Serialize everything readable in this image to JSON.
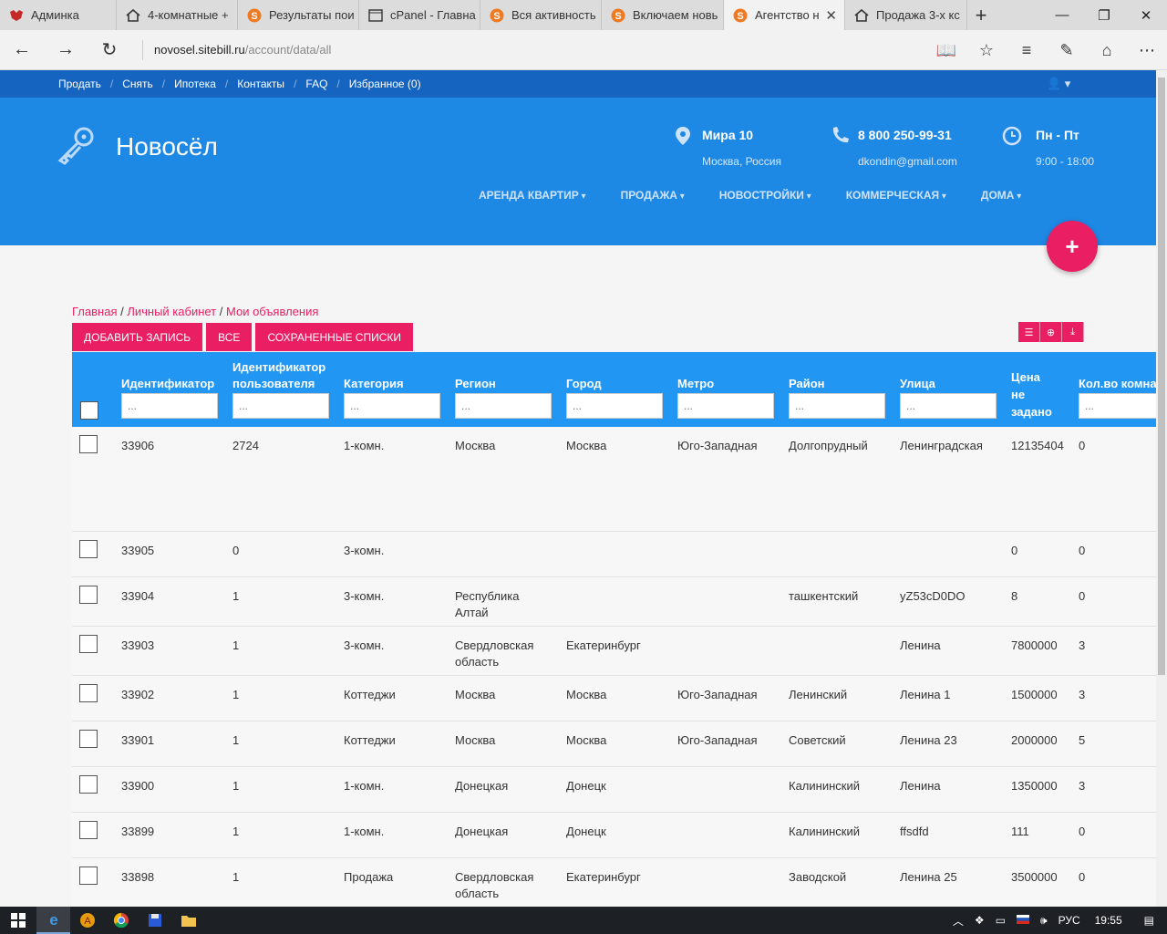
{
  "browser": {
    "tabs": [
      {
        "title": "Админка",
        "icon": "dog-icon"
      },
      {
        "title": "4-комнатные +",
        "icon": "house-icon"
      },
      {
        "title": "Результаты пои",
        "icon": "s-logo-icon"
      },
      {
        "title": "cPanel - Главна",
        "icon": "page-icon"
      },
      {
        "title": "Вся активность",
        "icon": "s-logo-icon"
      },
      {
        "title": "Включаем новь",
        "icon": "s-logo-icon"
      },
      {
        "title": "Агентство н",
        "icon": "s-logo-icon",
        "active": true
      },
      {
        "title": "Продажа 3-х кс",
        "icon": "house-icon"
      }
    ],
    "url_host": "novosel.sitebill.ru",
    "url_path": "/account/data/all"
  },
  "site": {
    "topnav": [
      "Продать",
      "Снять",
      "Ипотека",
      "Контакты",
      "FAQ",
      "Избранное (0)"
    ],
    "brand": "Новосёл",
    "address_title": "Мира 10",
    "address_sub": "Москва, Россия",
    "phone_title": "8 800 250-99-31",
    "phone_sub": "dkondin@gmail.com",
    "hours_title": "Пн - Пт",
    "hours_sub": "9:00 - 18:00",
    "menu": [
      "АРЕНДА КВАРТИР",
      "ПРОДАЖА",
      "НОВОСТРОЙКИ",
      "КОММЕРЧЕСКАЯ",
      "ДОМА"
    ],
    "fab_label": "+",
    "accent": "#e91e63",
    "header_color": "#1e88e5",
    "topbar_color": "#1565c0"
  },
  "breadcrumb": {
    "items": [
      "Главная",
      "Личный кабинет",
      "Мои объявления"
    ],
    "sep": " / "
  },
  "actions": {
    "add": "Добавить запись",
    "all": "Все",
    "saved": "Сохраненные списки"
  },
  "grid": {
    "filter_placeholder": "...",
    "headers": {
      "id": "Идентификатор",
      "user": "Идентификатор пользователя",
      "category": "Категория",
      "region": "Регион",
      "city": "Город",
      "metro": "Метро",
      "district": "Район",
      "street": "Улица",
      "price": "Цена не задано",
      "rooms": "Кол.во комнат"
    },
    "rows": [
      {
        "id": "33906",
        "user": "2724",
        "category": "1-комн.",
        "region": "Москва",
        "city": "Москва",
        "metro": "Юго-Западная",
        "district": "Долгопрудный",
        "street": "Ленинградская",
        "price": "12135404",
        "rooms": "0"
      },
      {
        "id": "33905",
        "user": "0",
        "category": "3-комн.",
        "region": "",
        "city": "",
        "metro": "",
        "district": "",
        "street": "",
        "price": "0",
        "rooms": "0"
      },
      {
        "id": "33904",
        "user": "1",
        "category": "3-комн.",
        "region": "Республика Алтай",
        "city": "",
        "metro": "",
        "district": "ташкентский",
        "street": "yZ53cD0DO",
        "price": "8",
        "rooms": "0"
      },
      {
        "id": "33903",
        "user": "1",
        "category": "3-комн.",
        "region": "Свердловская область",
        "city": "Екатеринбург",
        "metro": "",
        "district": "",
        "street": "Ленина",
        "price": "7800000",
        "rooms": "3"
      },
      {
        "id": "33902",
        "user": "1",
        "category": "Коттеджи",
        "region": "Москва",
        "city": "Москва",
        "metro": "Юго-Западная",
        "district": "Ленинский",
        "street": "Ленина 1",
        "price": "1500000",
        "rooms": "3"
      },
      {
        "id": "33901",
        "user": "1",
        "category": "Коттеджи",
        "region": "Москва",
        "city": "Москва",
        "metro": "Юго-Западная",
        "district": "Советский",
        "street": "Ленина 23",
        "price": "2000000",
        "rooms": "5"
      },
      {
        "id": "33900",
        "user": "1",
        "category": "1-комн.",
        "region": "Донецкая",
        "city": "Донецк",
        "metro": "",
        "district": "Калининский",
        "street": "Ленина",
        "price": "1350000",
        "rooms": "3"
      },
      {
        "id": "33899",
        "user": "1",
        "category": "1-комн.",
        "region": "Донецкая",
        "city": "Донецк",
        "metro": "",
        "district": "Калининский",
        "street": "ffsdfd",
        "price": "111",
        "rooms": "0"
      },
      {
        "id": "33898",
        "user": "1",
        "category": "Продажа",
        "region": "Свердловская область",
        "city": "Екатеринбург",
        "metro": "",
        "district": "Заводской",
        "street": "Ленина 25",
        "price": "3500000",
        "rooms": "0"
      }
    ]
  },
  "taskbar": {
    "lang": "РУС",
    "time": "19:55"
  }
}
